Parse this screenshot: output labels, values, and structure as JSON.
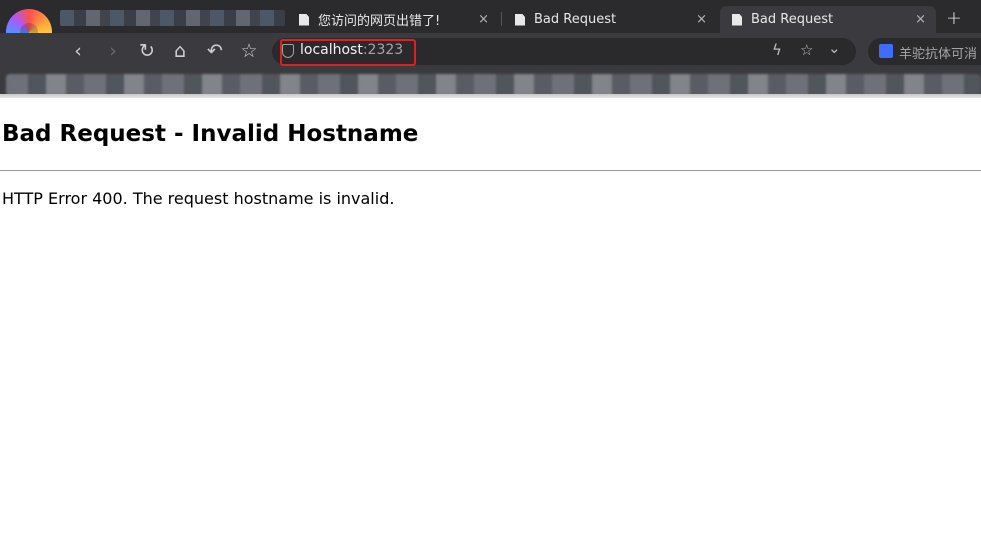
{
  "browser": {
    "tabs": [
      {
        "title": "您访问的网页出错了!",
        "close": "×",
        "active": false
      },
      {
        "title": "Bad Request",
        "close": "×",
        "active": false
      },
      {
        "title": "Bad Request",
        "close": "×",
        "active": true
      }
    ],
    "new_tab_label": "+",
    "nav": {
      "back": "‹",
      "forward": "›",
      "reload": "↻",
      "home": "⌂",
      "undo": "↶",
      "favorite": "☆"
    },
    "address": {
      "host": "localhost",
      "port": ":2323",
      "lightning": "ϟ",
      "star": "☆",
      "dropdown": "⌄"
    },
    "search": {
      "text": "羊驼抗体可消"
    }
  },
  "page": {
    "heading": "Bad Request - Invalid Hostname",
    "message": "HTTP Error 400. The request hostname is invalid."
  },
  "colors": {
    "chrome_bg": "#2b2b2e",
    "toolbar_bg": "#3b3b3f",
    "highlight": "#e02020"
  }
}
